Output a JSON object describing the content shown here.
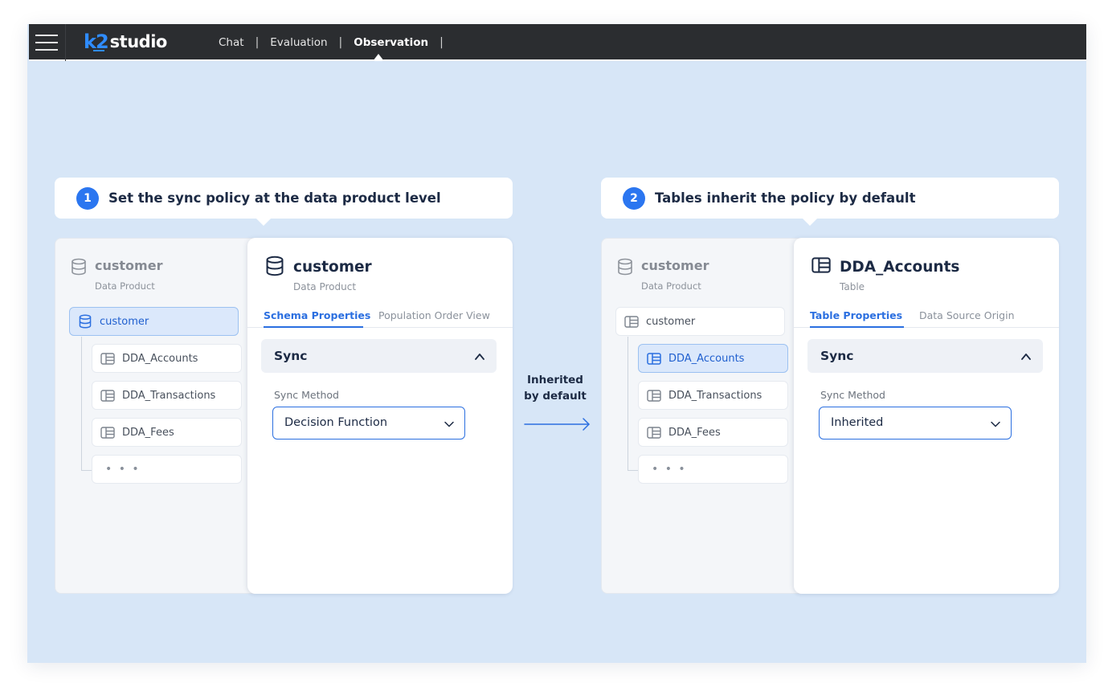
{
  "topbar": {
    "brand_k2": "k2",
    "brand_studio": "studio",
    "nav": [
      "Chat",
      "Evaluation",
      "Observation"
    ],
    "active_nav": "Observation"
  },
  "step1": {
    "number": "1",
    "text": "Set the sync policy at the data product level",
    "tree": {
      "root_title": "customer",
      "root_sub": "Data Product",
      "selected_node": "customer",
      "children": [
        "DDA_Accounts",
        "DDA_Transactions",
        "DDA_Fees"
      ],
      "more": "• • •"
    },
    "detail": {
      "title": "customer",
      "sub": "Data Product",
      "tabs": [
        "Schema Properties",
        "Population Order View"
      ],
      "section": "Sync",
      "field_label": "Sync Method",
      "field_value": "Decision Function"
    }
  },
  "middle": {
    "line1": "Inherited",
    "line2": "by default"
  },
  "step2": {
    "number": "2",
    "text": "Tables inherit the policy by default",
    "tree": {
      "root_title": "customer",
      "root_sub": "Data Product",
      "parent_node": "customer",
      "children": [
        "DDA_Accounts",
        "DDA_Transactions",
        "DDA_Fees"
      ],
      "selected_child": "DDA_Accounts",
      "more": "• • •"
    },
    "detail": {
      "title": "DDA_Accounts",
      "sub": "Table",
      "tabs": [
        "Table Properties",
        "Data Source Origin"
      ],
      "section": "Sync",
      "field_label": "Sync Method",
      "field_value": "Inherited"
    }
  },
  "colors": {
    "accent": "#2b6fe0",
    "background": "#d7e6f7",
    "topbar": "#2b2d30"
  },
  "icons": [
    "menu-icon",
    "database-icon",
    "table-icon",
    "chevron-up-icon",
    "chevron-down-icon",
    "arrow-right-icon"
  ]
}
